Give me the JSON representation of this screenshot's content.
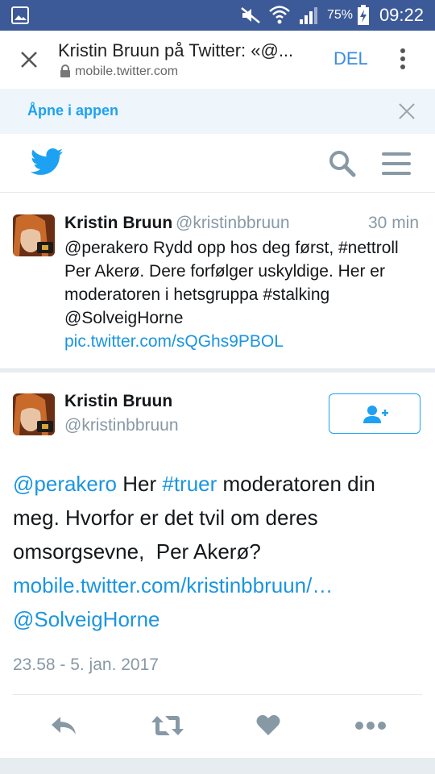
{
  "status_bar": {
    "battery": "75%",
    "time": "09:22"
  },
  "browser": {
    "title": "Kristin Bruun på Twitter: «@...",
    "url": "mobile.twitter.com",
    "share_label": "DEL"
  },
  "app_banner": {
    "open_in_app": "Åpne i appen"
  },
  "tweet1": {
    "name": "Kristin Bruun",
    "handle": "@kristinbbruun",
    "time": "30 min",
    "line1": "@perakero Rydd opp hos deg først, #nettroll",
    "line2": "Per Akerø. Dere forfølger uskyldige. Her er",
    "line3": "moderatoren i hetsgruppa #stalking",
    "line4": "@SolveigHorne",
    "link": "pic.twitter.com/sQGhs9PBOL"
  },
  "tweet2": {
    "name": "Kristin Bruun",
    "handle": "@kristinbbruun",
    "mention": "@perakero",
    "text_a": " Her ",
    "hashtag": "#truer",
    "text_b": " moderatoren din",
    "line2": "meg. Hvorfor er det tvil om deres",
    "line3": "omsorgsevne,  Per Akerø?",
    "link": "mobile.twitter.com/kristinbbruun/…",
    "mention2": "@SolveigHorne",
    "timestamp": "23.58 - 5. jan. 2017"
  },
  "colors": {
    "status_bar": "#3d5a98",
    "twitter_blue": "#1da1f2",
    "link_blue": "#1b95e0",
    "gray_text": "#8899a6"
  },
  "icons": [
    "image-icon",
    "mute-icon",
    "wifi-icon",
    "signal-icon",
    "battery-icon",
    "close-icon",
    "lock-icon",
    "more-vert-icon",
    "twitter-bird-icon",
    "search-icon",
    "menu-icon",
    "follow-icon",
    "reply-icon",
    "retweet-icon",
    "like-icon",
    "more-horiz-icon"
  ]
}
